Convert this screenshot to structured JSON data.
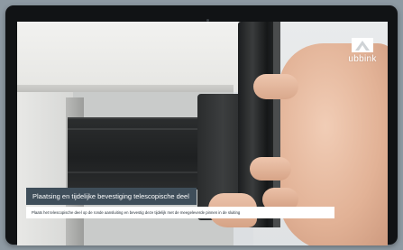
{
  "brand": {
    "name": "ubbink",
    "logo_icon": "ubbink-logo-icon"
  },
  "video": {
    "caption_title": "Plaatsing en tijdelijke bevestiging telescopische deel",
    "caption_description": "Plaats het telescopische deel op de ronde aansluiting en bevestig deze tijdelijk met de meegeleverde pinnen in de sluiting"
  },
  "colors": {
    "caption_title_bg": "#3f4e5a",
    "caption_desc_bg": "#ffffff",
    "device_frame": "#111315",
    "page_bg": "#8e9aa3"
  }
}
